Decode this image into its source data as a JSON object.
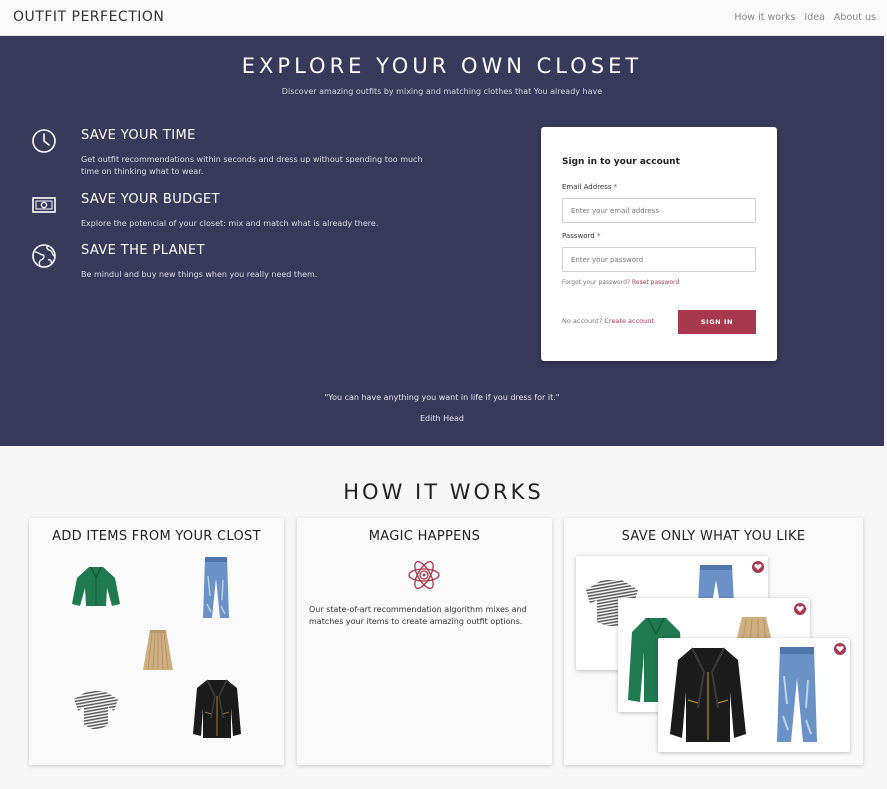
{
  "nav": {
    "brand": "OUTFIT PERFECTION",
    "links": [
      "How it works",
      "Idea",
      "About us"
    ]
  },
  "hero": {
    "title": "EXPLORE YOUR OWN CLOSET",
    "subtitle": "Discover amazing outfits by mixing and matching clothes that You already have",
    "features": [
      {
        "icon": "clock-icon",
        "title": "SAVE YOUR TIME",
        "desc": "Get outfit recommendations within seconds and dress up without spending too much time on thinking what to wear."
      },
      {
        "icon": "money-icon",
        "title": "SAVE YOUR BUDGET",
        "desc": "Explore the potencial of your closet: mix and match what is already there."
      },
      {
        "icon": "globe-icon",
        "title": "SAVE THE PLANET",
        "desc": "Be mindul and buy new things when you really need them."
      }
    ],
    "quote": "\"You can have anything you want in life if you dress for it.\"",
    "author": "Edith Head"
  },
  "signin": {
    "title": "Sign in to your account",
    "email_label": "Email Address",
    "email_placeholder": "Enter your email address",
    "password_label": "Password",
    "password_placeholder": "Enter your password",
    "required_mark": "*",
    "forgot_text": "Forgot your password?",
    "reset_link": "Reset password",
    "no_account_text": "No account?",
    "create_link": "Create account",
    "button": "SIGN IN"
  },
  "how_it_works": {
    "title": "HOW IT WORKS",
    "columns": [
      {
        "title": "ADD ITEMS FROM YOUR CLOST"
      },
      {
        "title": "MAGIC HAPPENS",
        "desc": "Our state-of-art recommendation algorithm mixes and matches your items to create amazing outfit options."
      },
      {
        "title": "SAVE ONLY WHAT YOU LIKE"
      }
    ]
  },
  "colors": {
    "hero_bg": "#383a5b",
    "accent": "#a8384e",
    "page_bg": "#f7f7f7"
  }
}
